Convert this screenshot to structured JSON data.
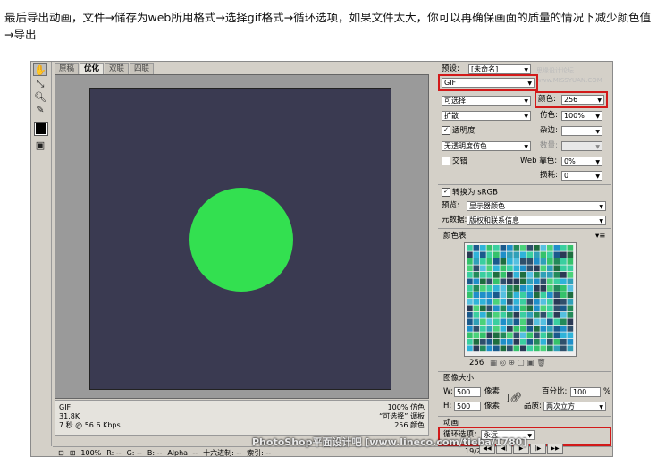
{
  "intro_text": "最后导出动画，文件→储存为web所用格式→选择gif格式→循环选项，如果文件太大，你可以再确保画面的质量的情况下减少颜色值→导出",
  "tabs": [
    "原稿",
    "优化",
    "双联",
    "四联"
  ],
  "status": {
    "format": "GIF",
    "size": "31.8K",
    "time": "7 秒 @ 56.6 Kbps",
    "dither_pct": "100% 仿色",
    "palette": "“可选择” 调板",
    "colors": "256 颜色"
  },
  "settings": {
    "preset_label": "预设:",
    "preset_value": "[未命名]",
    "format": "GIF",
    "reduction": "可选择",
    "colors_label": "颜色:",
    "colors_value": "256",
    "dither_algo": "扩散",
    "dither_label": "仿色:",
    "dither_value": "100%",
    "transparency": "透明度",
    "matte_label": "杂边:",
    "trans_dither": "无透明度仿色",
    "amount_label": "数量:",
    "interlaced": "交错",
    "web_snap_label": "Web 靠色:",
    "web_snap_value": "0%",
    "lossy_label": "损耗:",
    "lossy_value": "0",
    "convert_srgb": "转换为 sRGB",
    "preview_label": "预览:",
    "preview_value": "显示器颜色",
    "metadata_label": "元数据:",
    "metadata_value": "版权和联系信息",
    "color_table_label": "颜色表",
    "color_count": "256",
    "image_size_label": "图像大小",
    "w_label": "W:",
    "w_value": "500",
    "h_label": "H:",
    "h_value": "500",
    "px_unit": "像素",
    "percent_label": "百分比:",
    "percent_value": "100",
    "percent_unit": "%",
    "quality_label": "品质:",
    "quality_value": "两次立方",
    "animation_label": "动画",
    "loop_label": "循环选项:",
    "loop_value": "永远",
    "frame": "19/26"
  },
  "bottom": {
    "zoom": "100%",
    "r": "R: --",
    "g": "G: --",
    "b": "B: --",
    "alpha": "Alpha: --",
    "hex": "十六进制: --",
    "index": "索引: --"
  },
  "watermark": "PhotoShop平面设计吧  [www.lineco.com/tieba/1780]",
  "watermark_top": "思缘设计论坛 www.MISSYUAN.COM",
  "colors": {
    "canvas": "#3a3a51",
    "circle": "#33e050",
    "highlight": "#d21a1a"
  }
}
